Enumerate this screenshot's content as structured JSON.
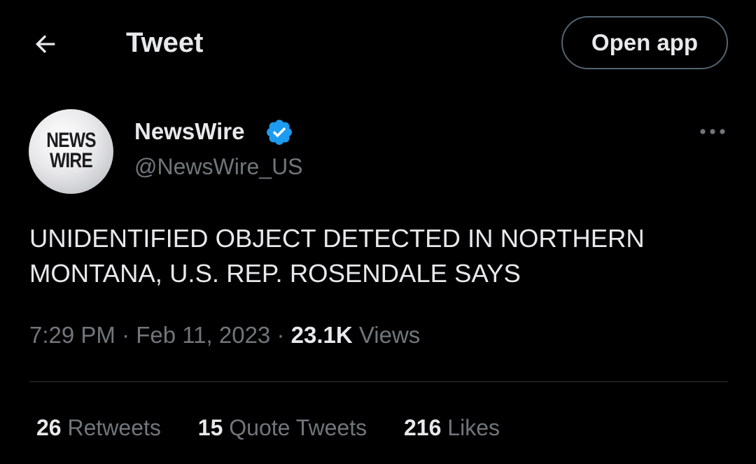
{
  "header": {
    "back_icon": "arrow-left-icon",
    "title": "Tweet",
    "open_app_label": "Open app"
  },
  "author": {
    "avatar_text_line1": "NEWS",
    "avatar_text_line2": "WIRE",
    "display_name": "NewsWire",
    "verified_icon": "verified-badge-icon",
    "verified_color": "#1d9bf0",
    "handle": "@NewsWire_US",
    "more_icon": "more-horizontal-icon"
  },
  "tweet": {
    "text": "UNIDENTIFIED OBJECT DETECTED IN NORTHERN MONTANA, U.S. REP. ROSENDALE SAYS",
    "time": "7:29 PM",
    "separator": "·",
    "date": "Feb 11, 2023",
    "views_count": "23.1K",
    "views_label": "Views"
  },
  "stats": {
    "retweets_count": "26",
    "retweets_label": "Retweets",
    "quotes_count": "15",
    "quotes_label": "Quote Tweets",
    "likes_count": "216",
    "likes_label": "Likes"
  },
  "colors": {
    "background": "#000000",
    "text_primary": "#e7e9ea",
    "text_secondary": "#71767b",
    "border": "#536471",
    "divider": "#2f3336"
  }
}
